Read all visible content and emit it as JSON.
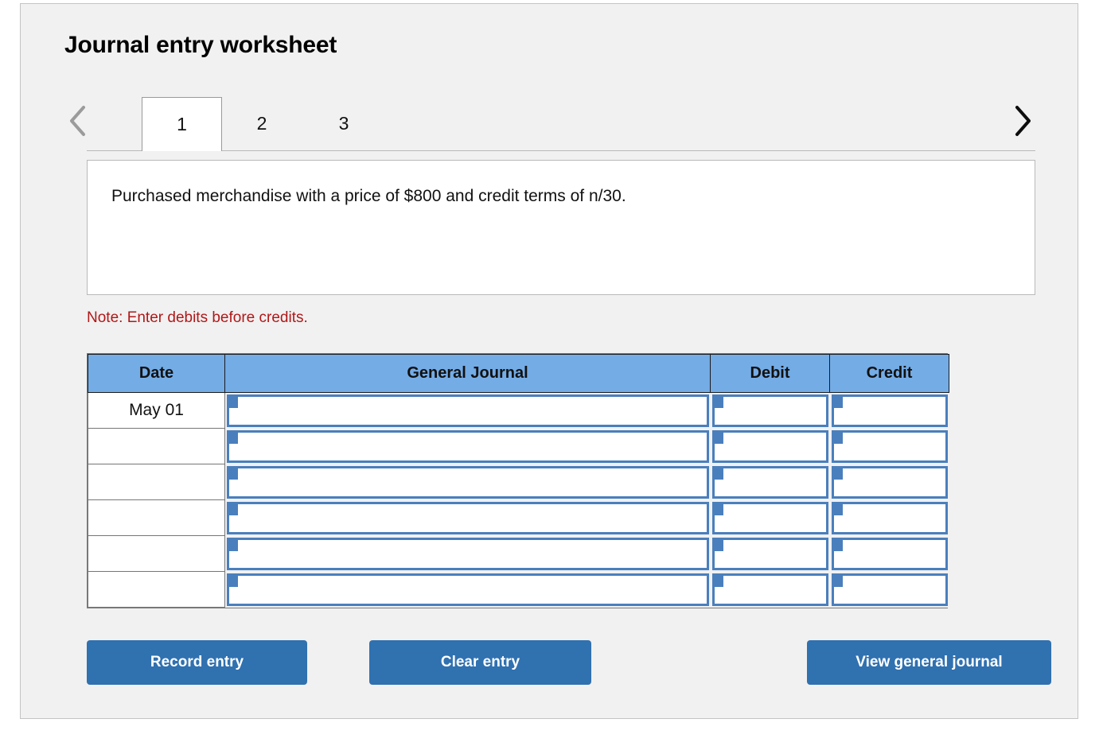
{
  "page": {
    "title": "Journal entry worksheet"
  },
  "tabs": {
    "prev_icon": "chevron-left-icon",
    "next_icon": "chevron-right-icon",
    "items": [
      {
        "label": "1",
        "active": true
      },
      {
        "label": "2",
        "active": false
      },
      {
        "label": "3",
        "active": false
      }
    ]
  },
  "description": {
    "text": "Purchased merchandise with a price of $800 and credit terms of n/30."
  },
  "note": {
    "text": "Note: Enter debits before credits."
  },
  "table": {
    "headers": {
      "date": "Date",
      "general_journal": "General Journal",
      "debit": "Debit",
      "credit": "Credit"
    },
    "rows": [
      {
        "date": "May 01",
        "general_journal": "",
        "debit": "",
        "credit": ""
      },
      {
        "date": "",
        "general_journal": "",
        "debit": "",
        "credit": ""
      },
      {
        "date": "",
        "general_journal": "",
        "debit": "",
        "credit": ""
      },
      {
        "date": "",
        "general_journal": "",
        "debit": "",
        "credit": ""
      },
      {
        "date": "",
        "general_journal": "",
        "debit": "",
        "credit": ""
      },
      {
        "date": "",
        "general_journal": "",
        "debit": "",
        "credit": ""
      }
    ]
  },
  "buttons": {
    "record": "Record entry",
    "clear": "Clear entry",
    "view": "View general journal"
  },
  "colors": {
    "header_blue": "#74ace6",
    "button_blue": "#3071b0",
    "note_red": "#b01818",
    "cell_border_blue": "#4a7fbd",
    "panel_bg": "#f1f1f1"
  }
}
